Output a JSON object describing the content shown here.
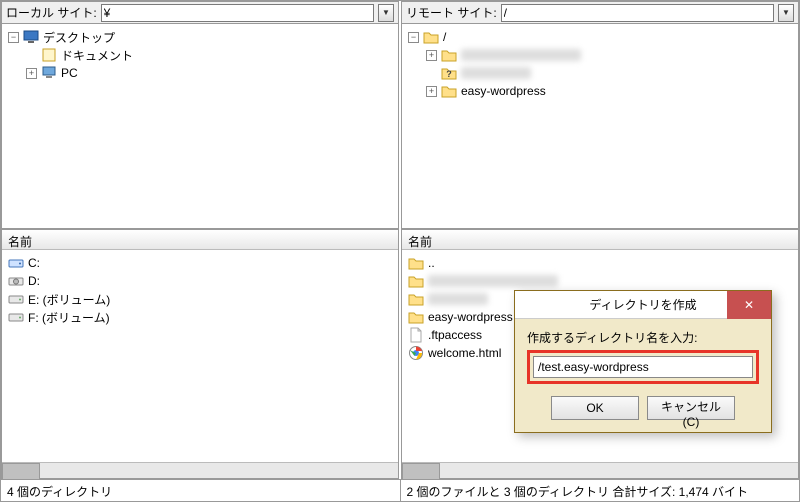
{
  "local": {
    "label": "ローカル サイト:",
    "path": "¥",
    "name_header": "名前",
    "tree": {
      "root": "デスクトップ",
      "items": [
        {
          "label": "ドキュメント",
          "icon": "doc"
        },
        {
          "label": "PC",
          "icon": "pc"
        }
      ]
    },
    "drives": [
      {
        "label": "C:",
        "icon": "drive-sys"
      },
      {
        "label": "D:",
        "icon": "drive-odd"
      },
      {
        "label": "E: (ボリューム)",
        "icon": "drive"
      },
      {
        "label": "F: (ボリューム)",
        "icon": "drive"
      }
    ],
    "status": "4 個のディレクトリ"
  },
  "remote": {
    "label": "リモート サイト:",
    "path": "/",
    "name_header": "名前",
    "tree": {
      "root": "/",
      "items": [
        {
          "label": "",
          "icon": "folder",
          "blur_w": 120
        },
        {
          "label": "",
          "icon": "unknown",
          "blur_w": 70
        },
        {
          "label": "easy-wordpress",
          "icon": "folder"
        }
      ]
    },
    "files": [
      {
        "label": "..",
        "icon": "folder"
      },
      {
        "label": "",
        "icon": "folder",
        "blur_w": 130
      },
      {
        "label": "",
        "icon": "folder",
        "blur_w": 60
      },
      {
        "label": "easy-wordpress",
        "icon": "folder"
      },
      {
        "label": ".ftpaccess",
        "icon": "file"
      },
      {
        "label": "welcome.html",
        "icon": "chrome"
      }
    ],
    "status": "2 個のファイルと 3 個のディレクトリ 合計サイズ: 1,474 バイト"
  },
  "dialog": {
    "title": "ディレクトリを作成",
    "label": "作成するディレクトリ名を入力:",
    "value": "/test.easy-wordpress",
    "ok": "OK",
    "cancel": "キャンセル(C)"
  }
}
